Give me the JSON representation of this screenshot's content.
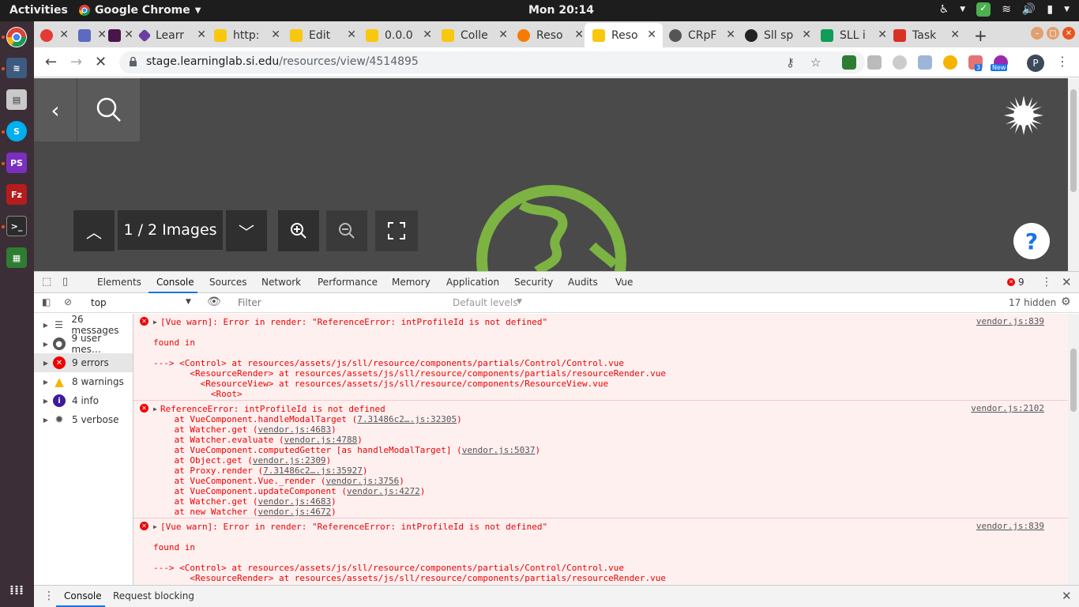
{
  "system": {
    "activities": "Activities",
    "app_name": "Google Chrome",
    "clock": "Mon 20:14"
  },
  "tabs": [
    {
      "label": "",
      "color": "#e53935"
    },
    {
      "label": "",
      "color": "#5c6bc0"
    },
    {
      "label": "",
      "color": "#4a154b"
    },
    {
      "label": "Learr",
      "color": "#6b3fa0"
    },
    {
      "label": "http:",
      "color": "#f9c80e"
    },
    {
      "label": "Edit",
      "color": "#f9c80e"
    },
    {
      "label": "0.0.0",
      "color": "#f9c80e"
    },
    {
      "label": "Colle",
      "color": "#f9c80e"
    },
    {
      "label": "Reso",
      "color": "#f57c00"
    },
    {
      "label": "Reso",
      "color": "#f9c80e"
    },
    {
      "label": "CRpF",
      "color": "#333333"
    },
    {
      "label": "Sll sp",
      "color": "#222222"
    },
    {
      "label": "SLL i",
      "color": "#0f9d58"
    },
    {
      "label": "Task",
      "color": "#d93025"
    }
  ],
  "address": {
    "host": "stage.learninglab.si.edu",
    "path": "/resources/view/4514895"
  },
  "extensions": {
    "badge_count": "3",
    "new_badge": "New",
    "profile_initial": "P"
  },
  "viewer": {
    "counter": "1 / 2 Images",
    "help": "?"
  },
  "devtools": {
    "tabs": [
      "Elements",
      "Console",
      "Sources",
      "Network",
      "Performance",
      "Memory",
      "Application",
      "Security",
      "Audits",
      "Vue"
    ],
    "error_count": "9",
    "context": "top",
    "filter_placeholder": "Filter",
    "levels": "Default levels",
    "hidden": "17 hidden"
  },
  "sidebar": {
    "items": [
      {
        "label": "26 messages"
      },
      {
        "label": "9 user mes…"
      },
      {
        "label": "9 errors"
      },
      {
        "label": "8 warnings"
      },
      {
        "label": "4 info"
      },
      {
        "label": "5 verbose"
      }
    ]
  },
  "messages": {
    "m1": {
      "title": "[Vue warn]: Error in render: \"ReferenceError: intProfileId is not defined\"",
      "src": "vendor.js:839",
      "found": "found in",
      "l1": "---> <Control> at resources/assets/js/sll/resource/components/partials/Control/Control.vue",
      "l2": "       <ResourceRender> at resources/assets/js/sll/resource/components/partials/resourceRender.vue",
      "l3": "         <ResourceView> at resources/assets/js/sll/resource/components/ResourceView.vue",
      "l4": "           <Root>"
    },
    "m2": {
      "title": "ReferenceError: intProfileId is not defined",
      "src": "vendor.js:2102",
      "s1a": "    at VueComponent.handleModalTarget (",
      "s1b": "7.31486c2….js:32305",
      "s1c": ")",
      "s2a": "    at Watcher.get (",
      "s2b": "vendor.js:4683",
      "s2c": ")",
      "s3a": "    at Watcher.evaluate (",
      "s3b": "vendor.js:4788",
      "s3c": ")",
      "s4a": "    at VueComponent.computedGetter [as handleModalTarget] (",
      "s4b": "vendor.js:5037",
      "s4c": ")",
      "s5a": "    at Object.get (",
      "s5b": "vendor.js:2309",
      "s5c": ")",
      "s6a": "    at Proxy.render (",
      "s6b": "7.31486c2….js:35927",
      "s6c": ")",
      "s7a": "    at VueComponent.Vue._render (",
      "s7b": "vendor.js:3756",
      "s7c": ")",
      "s8a": "    at VueComponent.updateComponent (",
      "s8b": "vendor.js:4272",
      "s8c": ")",
      "s9a": "    at Watcher.get (",
      "s9b": "vendor.js:4683",
      "s9c": ")",
      "s10a": "    at new Watcher (",
      "s10b": "vendor.js:4672",
      "s10c": ")"
    },
    "m3": {
      "title": "[Vue warn]: Error in render: \"ReferenceError: intProfileId is not defined\"",
      "src": "vendor.js:839",
      "found": "found in",
      "l1": "---> <Control> at resources/assets/js/sll/resource/components/partials/Control/Control.vue",
      "l2": "       <ResourceRender> at resources/assets/js/sll/resource/components/partials/resourceRender.vue"
    }
  },
  "drawer": {
    "tab1": "Console",
    "tab2": "Request blocking"
  }
}
